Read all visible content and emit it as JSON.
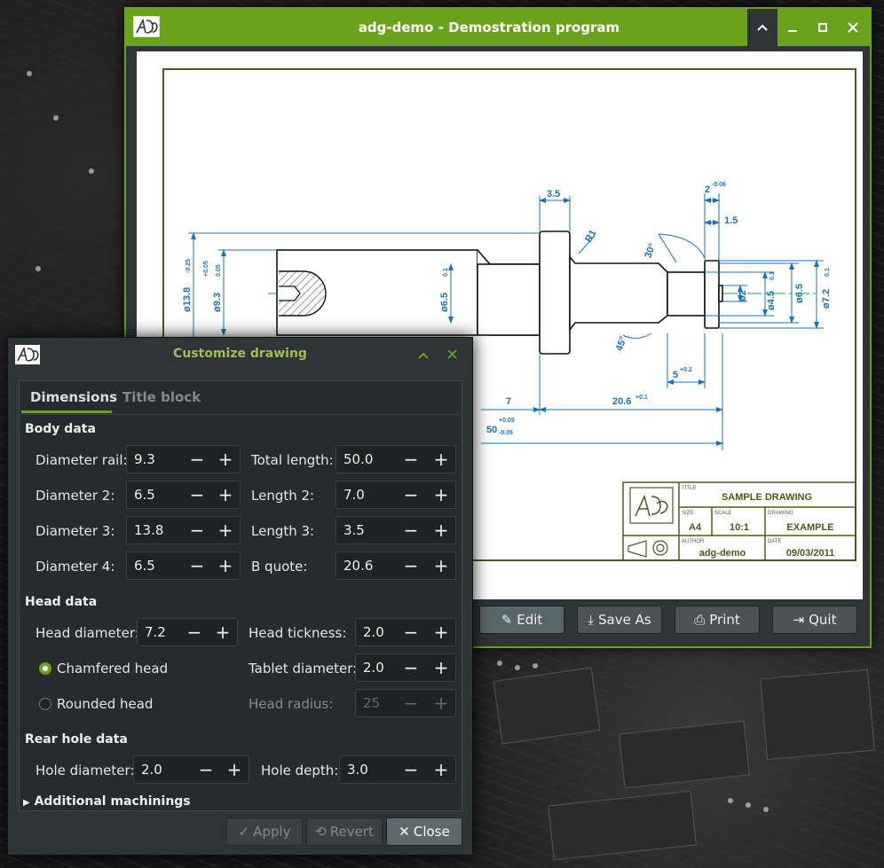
{
  "main_window": {
    "title": "adg-demo - Demostration program",
    "controls": {
      "up": "⌃",
      "minimize": "–",
      "maximize": "▫",
      "close": "✕"
    },
    "buttons": {
      "edit": "Edit",
      "save_as": "Save As",
      "print": "Print",
      "quit": "Quit"
    }
  },
  "drawing": {
    "dims": {
      "d35": "3.5",
      "d2": "2",
      "d2_tol": "-0.06",
      "d15": "1.5",
      "r1": "R1",
      "a30": "30°",
      "d138": "ø13.8",
      "d138_tol": "-0.25",
      "d93": "ø9.3",
      "d93_tol_up": "+0.05",
      "d93_tol_dn": "0.05",
      "d65a": "ø6.5",
      "d65a_tol": "0.1",
      "phi2": "ø2",
      "d45": "ø4.5",
      "d45_tol": "0.1",
      "d65b": "ø6.5",
      "d72": "ø7.2",
      "d72_tol": "0.1",
      "a45": "45°",
      "d5": "5",
      "d5_tol": "+0.2",
      "d7": "7",
      "d206": "20.6",
      "d206_tol": "+0.1",
      "d50": "50",
      "d50_tol_up": "+0.05",
      "d50_tol_dn": "-0.05"
    },
    "title_block": {
      "title_lbl": "TITLE",
      "title": "SAMPLE DRAWING",
      "size_lbl": "SIZE",
      "size": "A4",
      "scale_lbl": "SCALE",
      "scale": "10:1",
      "drawing_lbl": "DRAWING",
      "drawing": "EXAMPLE",
      "author_lbl": "AUTHOR",
      "author": "adg-demo",
      "date_lbl": "DATE",
      "date": "09/03/2011"
    }
  },
  "dialog": {
    "title": "Customize drawing",
    "tabs": [
      "Dimensions",
      "Title block"
    ],
    "body_data": {
      "heading": "Body data",
      "fields": [
        {
          "label": "Diameter rail:",
          "value": "9.3"
        },
        {
          "label": "Total length:",
          "value": "50.0"
        },
        {
          "label": "Diameter 2:",
          "value": "6.5"
        },
        {
          "label": "Length 2:",
          "value": "7.0"
        },
        {
          "label": "Diameter 3:",
          "value": "13.8"
        },
        {
          "label": "Length 3:",
          "value": "3.5"
        },
        {
          "label": "Diameter 4:",
          "value": "6.5"
        },
        {
          "label": "B quote:",
          "value": "20.6"
        }
      ]
    },
    "head_data": {
      "heading": "Head data",
      "head_diameter": {
        "label": "Head diameter:",
        "value": "7.2"
      },
      "head_tickness": {
        "label": "Head tickness:",
        "value": "2.0"
      },
      "chamfered": "Chamfered head",
      "rounded": "Rounded head",
      "tablet_diameter": {
        "label": "Tablet diameter:",
        "value": "2.0"
      },
      "head_radius": {
        "label": "Head radius:",
        "value": "25"
      }
    },
    "rear_hole": {
      "heading": "Rear hole data",
      "hole_diameter": {
        "label": "Hole diameter:",
        "value": "2.0"
      },
      "hole_depth": {
        "label": "Hole depth:",
        "value": "3.0"
      }
    },
    "additional": "Additional machinings",
    "buttons": {
      "apply": "Apply",
      "revert": "Revert",
      "close": "Close"
    }
  },
  "colors": {
    "accent": "#6aa21c",
    "dim_line": "#1a73b8",
    "frame": "#4a5a1a"
  }
}
